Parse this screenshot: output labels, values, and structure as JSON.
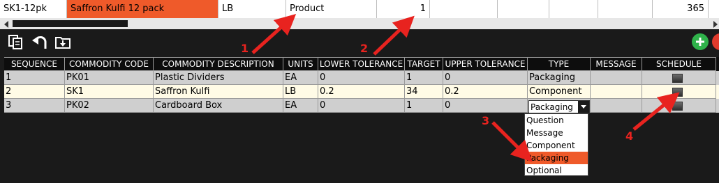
{
  "top_row": {
    "code": "SK1-12pk",
    "description": "Saffron Kulfi 12 pack",
    "unit": "LB",
    "type": "Product",
    "qty": "1",
    "value": "365",
    "highlight_color": "#ef5a2a"
  },
  "toolbar": {
    "icons": [
      "copy-icon",
      "undo-icon",
      "download-icon",
      "add-icon",
      "delete-icon"
    ],
    "add_color": "#2fb24a",
    "delete_color": "#e03b2c"
  },
  "grid": {
    "headers": [
      "SEQUENCE",
      "COMMODITY CODE",
      "COMMODITY DESCRIPTION",
      "UNITS",
      "LOWER TOLERANCE",
      "TARGET",
      "UPPER TOLERANCE",
      "TYPE",
      "MESSAGE",
      "SCHEDULE"
    ],
    "rows": [
      {
        "sequence": "1",
        "code": "PK01",
        "description": "Plastic Dividers",
        "units": "EA",
        "lower": "0",
        "target": "1",
        "upper": "0",
        "type": "Packaging",
        "message": ""
      },
      {
        "sequence": "2",
        "code": "SK1",
        "description": "Saffron Kulfi",
        "units": "LB",
        "lower": "0.2",
        "target": "34",
        "upper": "0.2",
        "type": "Component",
        "message": ""
      },
      {
        "sequence": "3",
        "code": "PK02",
        "description": "Cardboard Box",
        "units": "EA",
        "lower": "0",
        "target": "1",
        "upper": "0",
        "type": "Packaging",
        "message": ""
      }
    ],
    "row_colors": [
      "#cfcfcf",
      "#fffbe6",
      "#cfcfcf"
    ]
  },
  "type_dropdown": {
    "selected": "Packaging",
    "options": [
      "Question",
      "Message",
      "Component",
      "Packaging",
      "Optional"
    ]
  },
  "annotations": [
    "1",
    "2",
    "3",
    "4"
  ],
  "annotation_color": "#e8231f"
}
